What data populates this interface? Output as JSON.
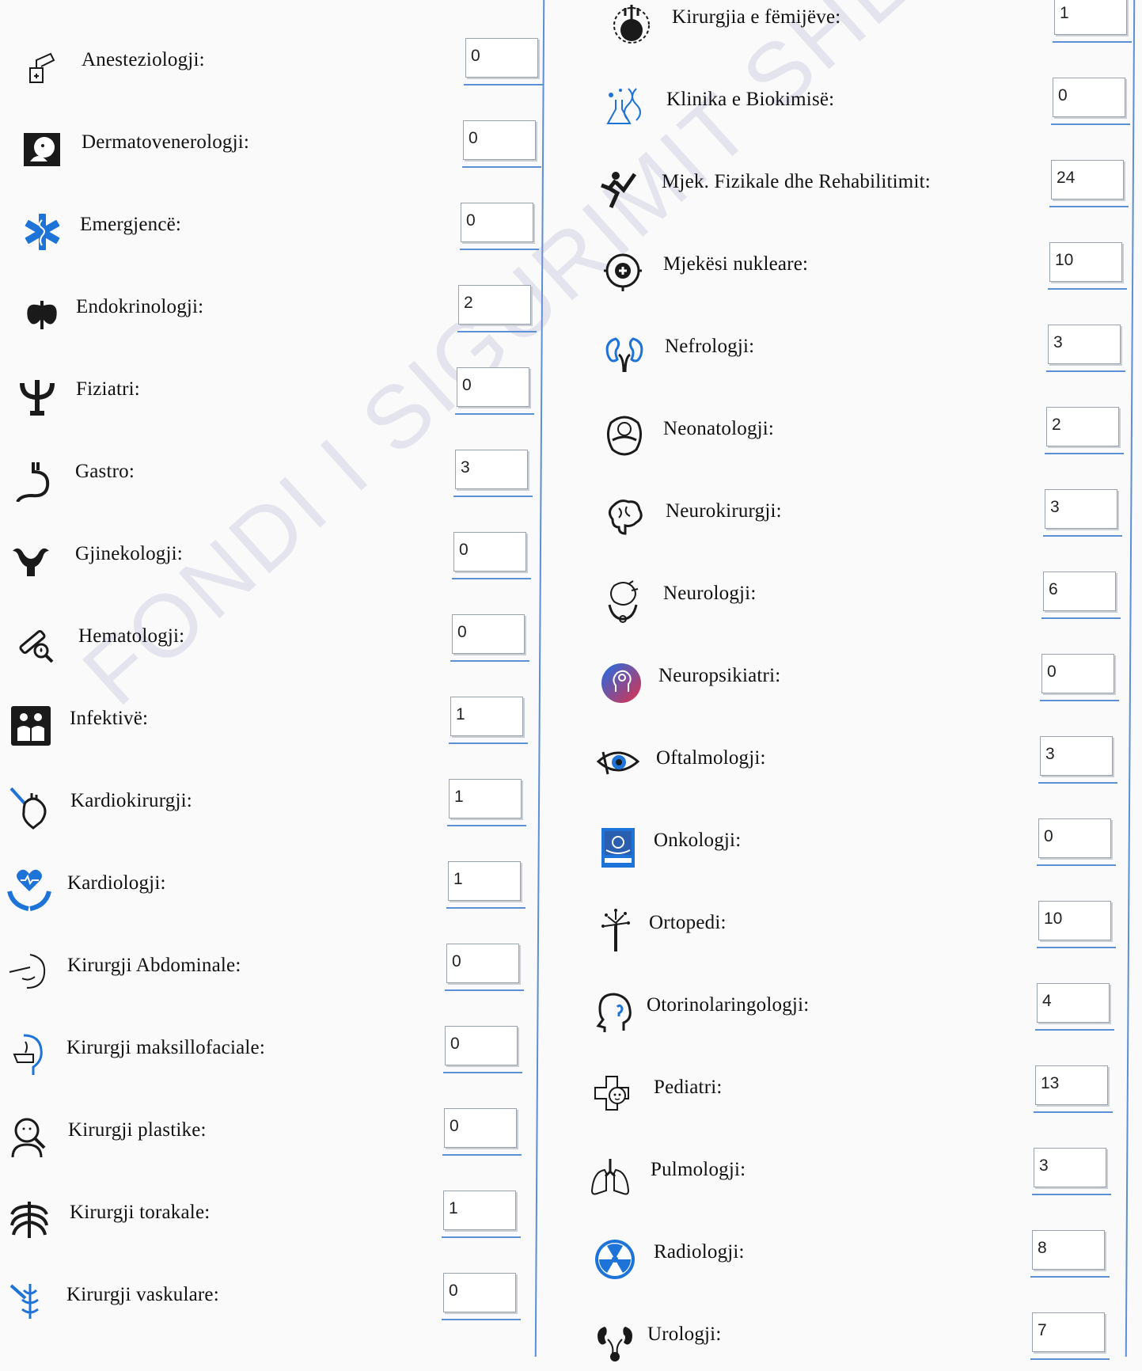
{
  "watermark": "FONDI I SIGURIMIT SHËNDETËSOR",
  "colors": {
    "line_blue": "#5b8fd6",
    "icon_blue": "#1e73d8"
  },
  "left_column": [
    {
      "label": "Anesteziologji:",
      "value": "0",
      "icon": "anesthesia-icon"
    },
    {
      "label": "Dermatovenerologji:",
      "value": "0",
      "icon": "dermatology-icon"
    },
    {
      "label": "Emergjencë:",
      "value": "0",
      "icon": "star-of-life-icon"
    },
    {
      "label": "Endokrinologji:",
      "value": "2",
      "icon": "thyroid-icon"
    },
    {
      "label": "Fiziatri:",
      "value": "0",
      "icon": "psi-icon"
    },
    {
      "label": "Gastro:",
      "value": "3",
      "icon": "stomach-icon"
    },
    {
      "label": "Gjinekologji:",
      "value": "0",
      "icon": "uterus-icon"
    },
    {
      "label": "Hematologji:",
      "value": "0",
      "icon": "blood-test-icon"
    },
    {
      "label": "Infektivë:",
      "value": "1",
      "icon": "infection-icon"
    },
    {
      "label": "Kardiokirurgji:",
      "value": "1",
      "icon": "heart-surgery-icon"
    },
    {
      "label": "Kardiologji:",
      "value": "1",
      "icon": "cardiology-icon"
    },
    {
      "label": "Kirurgji Abdominale:",
      "value": "0",
      "icon": "abdominal-icon"
    },
    {
      "label": "Kirurgji maksillofaciale:",
      "value": "0",
      "icon": "maxillofacial-icon"
    },
    {
      "label": "Kirurgji plastike:",
      "value": "0",
      "icon": "plastic-surgery-icon"
    },
    {
      "label": "Kirurgji torakale:",
      "value": "1",
      "icon": "ribcage-icon"
    },
    {
      "label": "Kirurgji vaskulare:",
      "value": "0",
      "icon": "vascular-icon"
    }
  ],
  "right_column": [
    {
      "label": "Kirurgjia e fëmijëve:",
      "value": "1",
      "icon": "pediatric-surgery-icon"
    },
    {
      "label": "Klinika e Biokimisë:",
      "value": "0",
      "icon": "biochemistry-icon"
    },
    {
      "label": "Mjek. Fizikale dhe Rehabilitimit:",
      "value": "24",
      "icon": "rehabilitation-icon"
    },
    {
      "label": "Mjekësi nukleare:",
      "value": "10",
      "icon": "nuclear-medicine-icon"
    },
    {
      "label": "Nefrologji:",
      "value": "3",
      "icon": "kidneys-icon"
    },
    {
      "label": "Neonatologji:",
      "value": "2",
      "icon": "newborn-icon"
    },
    {
      "label": "Neurokirurgji:",
      "value": "3",
      "icon": "brain-icon"
    },
    {
      "label": "Neurologji:",
      "value": "6",
      "icon": "neurology-icon"
    },
    {
      "label": "Neuropsikiatri:",
      "value": "0",
      "icon": "neuropsychiatry-icon"
    },
    {
      "label": "Oftalmologji:",
      "value": "3",
      "icon": "eye-icon"
    },
    {
      "label": "Onkologji:",
      "value": "0",
      "icon": "oncology-icon"
    },
    {
      "label": "Ortopedi:",
      "value": "10",
      "icon": "orthopedic-icon"
    },
    {
      "label": "Otorinolaringologji:",
      "value": "4",
      "icon": "ent-icon"
    },
    {
      "label": "Pediatri:",
      "value": "13",
      "icon": "pediatrics-icon"
    },
    {
      "label": "Pulmologji:",
      "value": "3",
      "icon": "lungs-icon"
    },
    {
      "label": "Radiologji:",
      "value": "8",
      "icon": "radiation-icon"
    },
    {
      "label": "Urologji:",
      "value": "7",
      "icon": "urology-icon"
    }
  ]
}
